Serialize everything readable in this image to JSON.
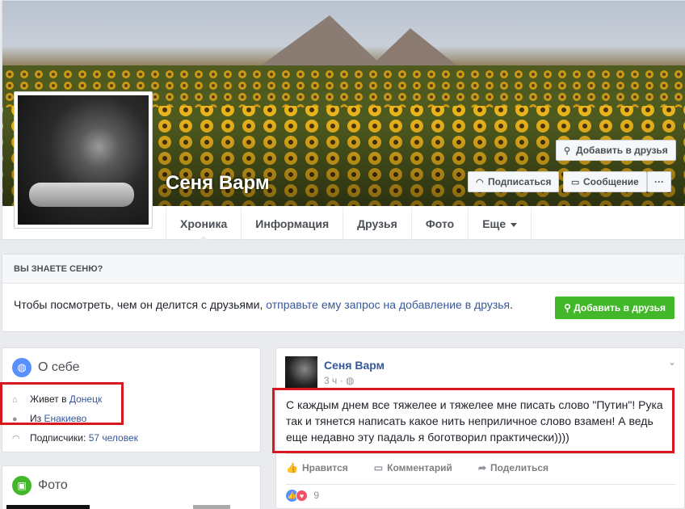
{
  "profile": {
    "name": "Сеня Варм",
    "add_friend_label": "Добавить в друзья",
    "subscribe_label": "Подписаться",
    "message_label": "Сообщение",
    "more_label": "···"
  },
  "tabs": [
    {
      "label": "Хроника"
    },
    {
      "label": "Информация"
    },
    {
      "label": "Друзья"
    },
    {
      "label": "Фото"
    },
    {
      "label": "Еще"
    }
  ],
  "know": {
    "title": "ВЫ ЗНАЕТЕ СЕНЮ?",
    "text": "Чтобы посмотреть, чем он делится с друзьями, ",
    "link": "отправьте ему запрос на добавление в друзья",
    "button": "Добавить в друзья"
  },
  "about": {
    "title": "О себе",
    "lives_prefix": "Живет в ",
    "lives_city": "Донецк",
    "from_prefix": "Из ",
    "from_city": "Енакиево",
    "followers_prefix": "Подписчики: ",
    "followers": "57 человек"
  },
  "photos": {
    "title": "Фото"
  },
  "post": {
    "author": "Сеня Варм",
    "time": "3 ч",
    "privacy_sep": " · ",
    "text": "С каждым днем все тяжелее и тяжелее мне писать слово \"Путин\"! Рука так и тянется написать какое нить неприличное слово взамен! А ведь еще недавно эту падаль я боготворил практически))))",
    "like_label": "Нравится",
    "comment_label": "Комментарий",
    "share_label": "Поделиться",
    "reactions_count": "9"
  },
  "colors": {
    "facebook_blue": "#365899",
    "green_button": "#42b72a",
    "highlight_red": "#d6191f"
  }
}
